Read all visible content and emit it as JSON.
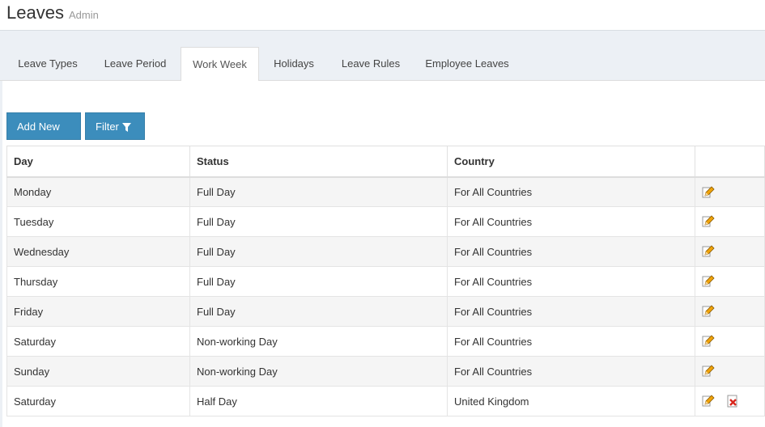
{
  "header": {
    "title": "Leaves",
    "subtitle": "Admin"
  },
  "tabs": [
    {
      "label": "Leave Types"
    },
    {
      "label": "Leave Period"
    },
    {
      "label": "Work Week",
      "active": true
    },
    {
      "label": "Holidays"
    },
    {
      "label": "Leave Rules"
    },
    {
      "label": "Employee Leaves"
    }
  ],
  "toolbar": {
    "add_label": "Add New",
    "filter_label": "Filter"
  },
  "table": {
    "columns": [
      "Day",
      "Status",
      "Country",
      ""
    ],
    "rows": [
      {
        "day": "Monday",
        "status": "Full Day",
        "country": "For All Countries",
        "deletable": false
      },
      {
        "day": "Tuesday",
        "status": "Full Day",
        "country": "For All Countries",
        "deletable": false
      },
      {
        "day": "Wednesday",
        "status": "Full Day",
        "country": "For All Countries",
        "deletable": false
      },
      {
        "day": "Thursday",
        "status": "Full Day",
        "country": "For All Countries",
        "deletable": false
      },
      {
        "day": "Friday",
        "status": "Full Day",
        "country": "For All Countries",
        "deletable": false
      },
      {
        "day": "Saturday",
        "status": "Non-working Day",
        "country": "For All Countries",
        "deletable": false
      },
      {
        "day": "Sunday",
        "status": "Non-working Day",
        "country": "For All Countries",
        "deletable": false
      },
      {
        "day": "Saturday",
        "status": "Half Day",
        "country": "United Kingdom",
        "deletable": true
      }
    ]
  },
  "icons": {
    "edit": "edit-pencil-icon",
    "delete": "delete-x-icon",
    "add": "plus-icon",
    "filter": "funnel-icon"
  },
  "colors": {
    "primary": "#3c8dbc",
    "delete": "#d9261c",
    "edit": "#f0a30a"
  }
}
